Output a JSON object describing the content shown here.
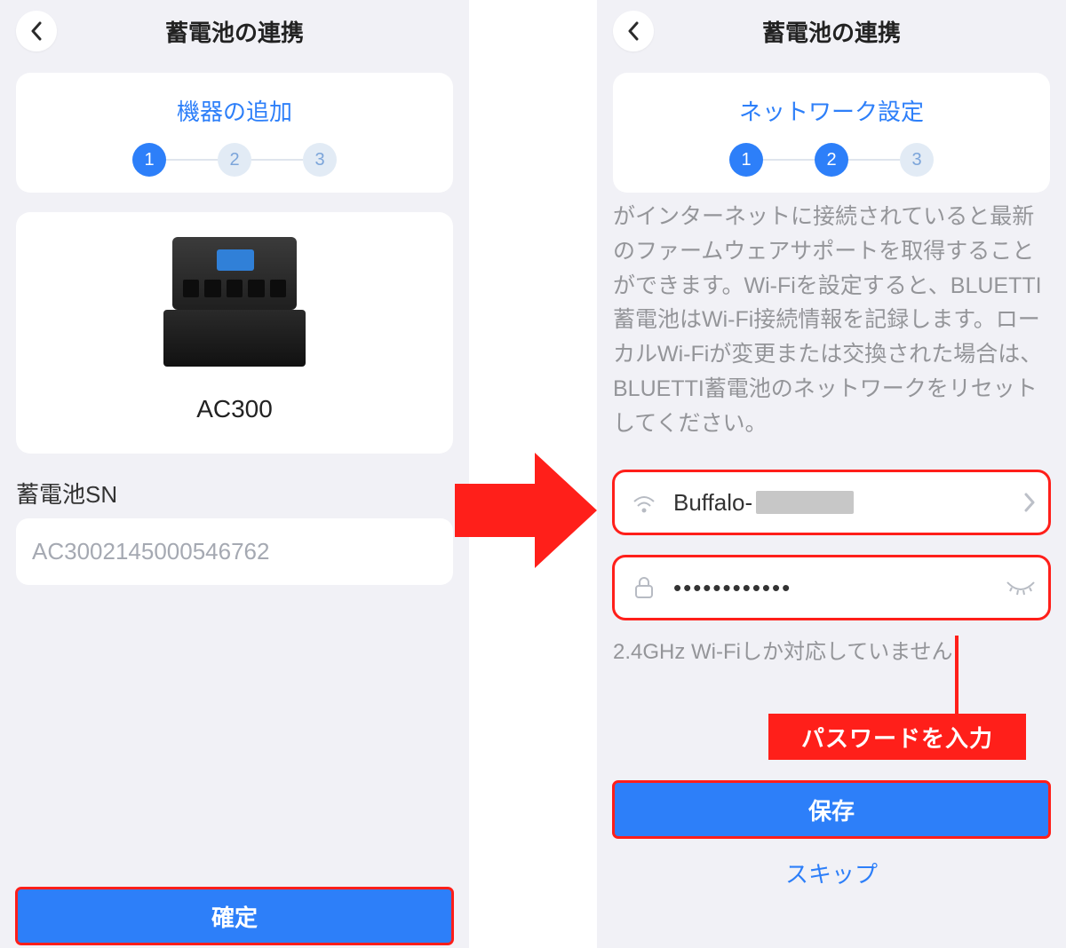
{
  "left": {
    "header_title": "蓄電池の連携",
    "step_card_title": "機器の追加",
    "steps": [
      "1",
      "2",
      "3"
    ],
    "active_steps": [
      1
    ],
    "device_name": "AC300",
    "sn_label": "蓄電池SN",
    "sn_value": "AC3002145000546762",
    "confirm_label": "確定"
  },
  "right": {
    "header_title": "蓄電池の連携",
    "step_card_title": "ネットワーク設定",
    "steps": [
      "1",
      "2",
      "3"
    ],
    "active_steps": [
      1,
      2
    ],
    "description": "がインターネットに接続されていると最新のファームウェアサポートを取得することができます。Wi-Fiを設定すると、BLUETTI蓄電池はWi-Fi接続情報を記録します。ローカルWi-Fiが変更または交換された場合は、BLUETTI蓄電池のネットワークをリセットしてください。",
    "wifi_prefix": "Buffalo-",
    "password_mask": "••••••••••••",
    "wifi_note": "2.4GHz Wi-Fiしか対応していません",
    "save_label": "保存",
    "skip_label": "スキップ"
  },
  "callout_label": "パスワードを入力",
  "colors": {
    "accent": "#2d7ff9",
    "highlight": "#ff1f1a"
  }
}
